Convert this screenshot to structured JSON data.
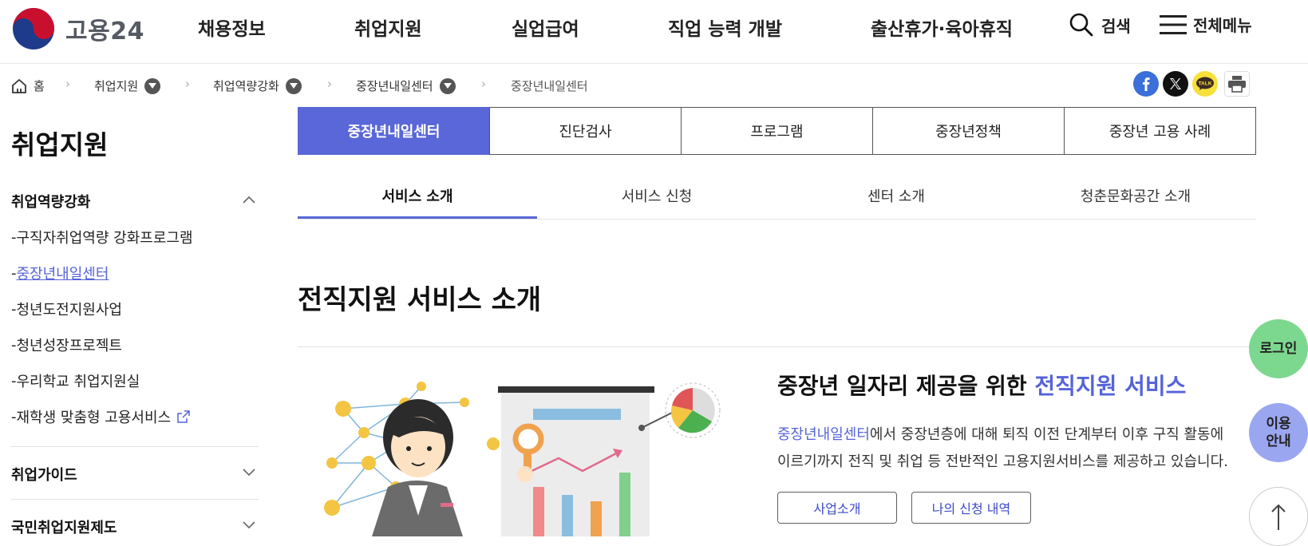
{
  "header": {
    "logo_text": "고용24",
    "nav": [
      "채용정보",
      "취업지원",
      "실업급여",
      "직업 능력 개발",
      "출산휴가·육아휴직"
    ],
    "search_label": "검색",
    "menu_label": "전체메뉴"
  },
  "breadcrumb": {
    "home": "홈",
    "items": [
      "취업지원",
      "취업역량강화",
      "중장년내일센터",
      "중장년내일센터"
    ]
  },
  "sidebar": {
    "title": "취업지원",
    "group1": {
      "label": "취업역량강화",
      "items": [
        "구직자취업역량 강화프로그램",
        "중장년내일센터",
        "청년도전지원사업",
        "청년성장프로젝트",
        "우리학교 취업지원실",
        "재학생 맞춤형 고용서비스"
      ]
    },
    "group2": "취업가이드",
    "group3": "국민취업지원제도"
  },
  "tabs_primary": [
    "중장년내일센터",
    "진단검사",
    "프로그램",
    "중장년정책",
    "중장년 고용 사례"
  ],
  "tabs_secondary": [
    "서비스 소개",
    "서비스 신청",
    "센터 소개",
    "청춘문화공간 소개"
  ],
  "content": {
    "section_title": "전직지원 서비스 소개",
    "headline_prefix": "중장년 일자리 제공을 위한 ",
    "headline_accent": "전직지원 서비스",
    "desc_accent": "중장년내일센터",
    "desc_line1": "에서 중장년층에 대해 퇴직 이전 단계부터 이후 구직 활동에",
    "desc_line2": "이르기까지 전직 및 취업 등 전반적인 고용지원서비스를 제공하고 있습니다.",
    "btn_intro": "사업소개",
    "btn_my": "나의 신청 내역"
  },
  "floating": {
    "login": "로그인",
    "guide_line1": "이용",
    "guide_line2": "안내"
  },
  "share": {
    "talk_label": "TALK"
  },
  "colors": {
    "accent": "#5a67d8",
    "login_bg": "#7dd88f",
    "guide_bg": "#9aa6f0"
  }
}
